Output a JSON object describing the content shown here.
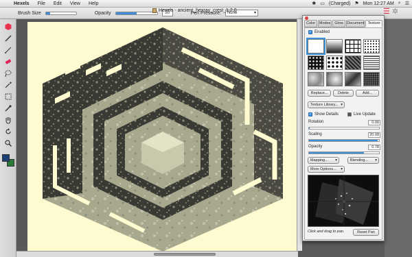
{
  "menubar": {
    "app_name": "Hexels",
    "menus": [
      "File",
      "Edit",
      "View",
      "Help"
    ],
    "battery": "(Charged)",
    "clock": "Mon 12:27 AM"
  },
  "window": {
    "title": "Hexels - ancient_hexray_crest_1.2.0"
  },
  "options": {
    "brush_size_label": "Brush Size",
    "brush_size": 0.15,
    "opacity_label": "Opacity",
    "opacity_value": "50",
    "opacity_fraction": 0.5,
    "pen_pressure_label": "Pen Pressure:",
    "pen_pressure_value": "None"
  },
  "colors": {
    "primary": "#1c3f74",
    "secondary": "#2a7a3a",
    "accent": "#3d8fdc",
    "canvas_bg": "#fffbd0"
  },
  "tools": [
    "hexagon-icon",
    "pen-icon",
    "line-icon",
    "eraser-icon",
    "lasso-icon",
    "magic-wand-icon",
    "marquee-icon",
    "eyedropper-icon",
    "hand-icon",
    "rotate-icon",
    "zoom-icon"
  ],
  "panel": {
    "tabs": [
      "Color",
      "Modes",
      "Glow",
      "Document",
      "Texture"
    ],
    "active_tab": "Texture",
    "enabled_label": "Enabled",
    "replace_label": "Replace...",
    "delete_label": "Delete",
    "add_label": "Add...",
    "library_label": "Texture Library...",
    "show_details_label": "Show Details",
    "live_update_label": "Live Update",
    "rotation_label": "Rotation",
    "rotation_value": "0.00",
    "scaling_label": "Scaling",
    "scaling_value": "20.08",
    "opacity_label": "Opacity",
    "opacity_value": "0.78",
    "mapping_label": "Mapping...",
    "blending_label": "Blending...",
    "more_options_label": "More Options...",
    "footer_hint": "Click and drag to pan.",
    "reset_pan_label": "Reset Pan"
  }
}
